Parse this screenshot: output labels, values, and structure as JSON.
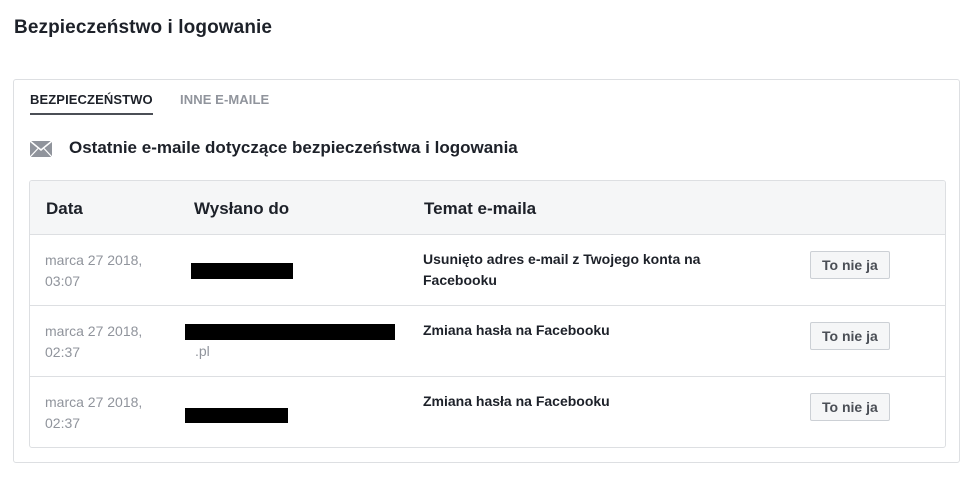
{
  "page": {
    "title": "Bezpieczeństwo i logowanie"
  },
  "tabs": [
    {
      "label": "BEZPIECZEŃSTWO",
      "active": true
    },
    {
      "label": "INNE E-MAILE",
      "active": false
    }
  ],
  "section": {
    "icon": "envelope-icon",
    "title": "Ostatnie e-maile dotyczące bezpieczeństwa i logowania"
  },
  "table": {
    "columns": [
      "Data",
      "Wysłano do",
      "Temat e-maila"
    ],
    "rows": [
      {
        "date_line1": "marca 27 2018,",
        "date_line2": "03:07",
        "recipient_suffix": "",
        "subject": "Usunięto adres e-mail z Twojego konta na Facebooku",
        "action": "To nie ja"
      },
      {
        "date_line1": "marca 27 2018,",
        "date_line2": "02:37",
        "recipient_suffix": ".pl",
        "subject": "Zmiana hasła na Facebooku",
        "action": "To nie ja"
      },
      {
        "date_line1": "marca 27 2018,",
        "date_line2": "02:37",
        "recipient_suffix": "",
        "subject": "Zmiana hasła na Facebooku",
        "action": "To nie ja"
      }
    ]
  },
  "colors": {
    "heading": "#1d2129",
    "muted": "#90949c",
    "border": "#dddfe2",
    "header_bg": "#f5f6f7"
  }
}
